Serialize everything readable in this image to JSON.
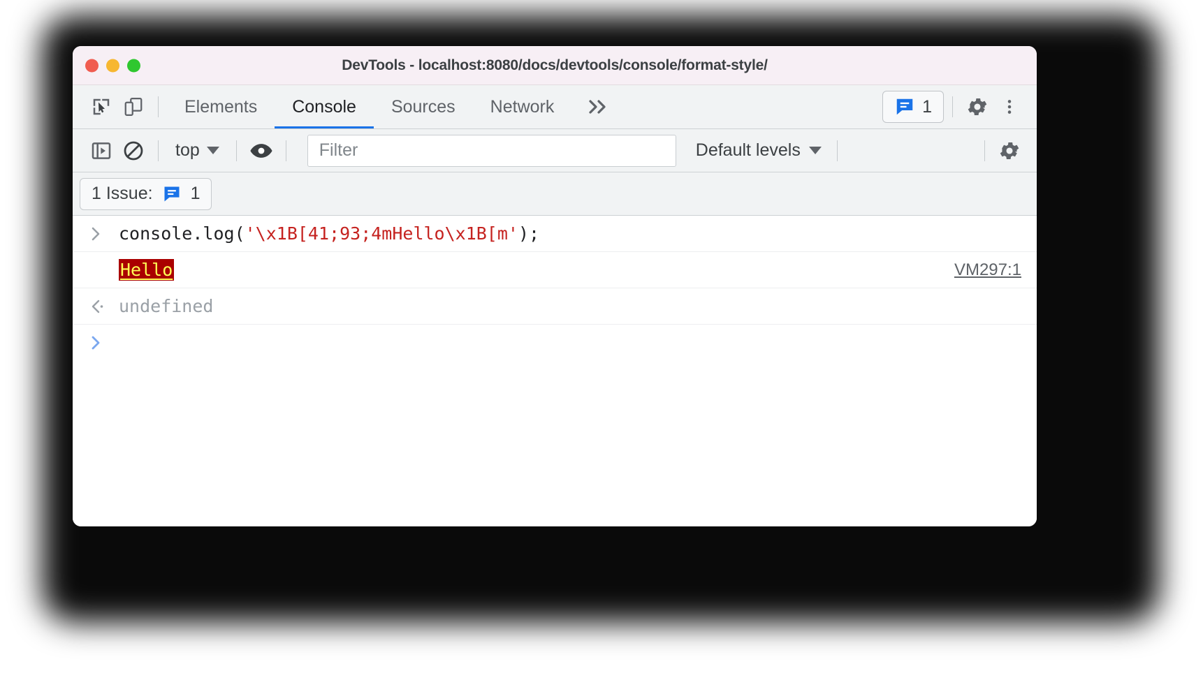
{
  "window": {
    "title": "DevTools - localhost:8080/docs/devtools/console/format-style/",
    "traffic_lights": [
      "close",
      "minimize",
      "maximize"
    ],
    "colors": {
      "titlebar_bg": "#f7eff5",
      "toolbar_bg": "#f1f3f4",
      "accent_blue": "#1a73e8",
      "issue_blue": "#1a73e8"
    }
  },
  "tabstrip": {
    "inspect_icon": "inspect-cursor-icon",
    "device_icon": "device-toolbar-icon",
    "tabs": [
      {
        "label": "Elements",
        "active": false
      },
      {
        "label": "Console",
        "active": true
      },
      {
        "label": "Sources",
        "active": false
      },
      {
        "label": "Network",
        "active": false
      }
    ],
    "more_tabs_icon": "chevron-double-right-icon",
    "issues_badge": {
      "icon": "issue-message-icon",
      "count": "1"
    },
    "settings_icon": "gear-icon",
    "menu_icon": "three-dots-vertical-icon"
  },
  "console_toolbar": {
    "sidebar_toggle_icon": "console-sidebar-icon",
    "clear_icon": "clear-console-icon",
    "context": {
      "label": "top",
      "caret": "chevron-down-icon"
    },
    "live_expression_icon": "eye-icon",
    "filter": {
      "value": "",
      "placeholder": "Filter"
    },
    "log_levels": {
      "label": "Default levels",
      "caret": "chevron-down-icon"
    },
    "settings_icon": "gear-icon"
  },
  "issue_bar": {
    "label": "1 Issue:",
    "icon": "issue-message-icon",
    "count": "1"
  },
  "console": {
    "rows": [
      {
        "type": "input",
        "gutter_icon": "chevron-right-prompt-icon",
        "code_prefix": "console.log(",
        "code_string": "'\\x1B[41;93;4mHello\\x1B[m'",
        "code_suffix": ");"
      },
      {
        "type": "output",
        "gutter_icon": "none",
        "text": "Hello",
        "style": {
          "background": "#aa0000",
          "color": "#ffff55",
          "underline": true
        },
        "source_link": "VM297:1"
      },
      {
        "type": "result",
        "gutter_icon": "return-arrow-icon",
        "text": "undefined"
      },
      {
        "type": "prompt",
        "gutter_icon": "chevron-right-prompt-icon",
        "text": ""
      }
    ]
  }
}
